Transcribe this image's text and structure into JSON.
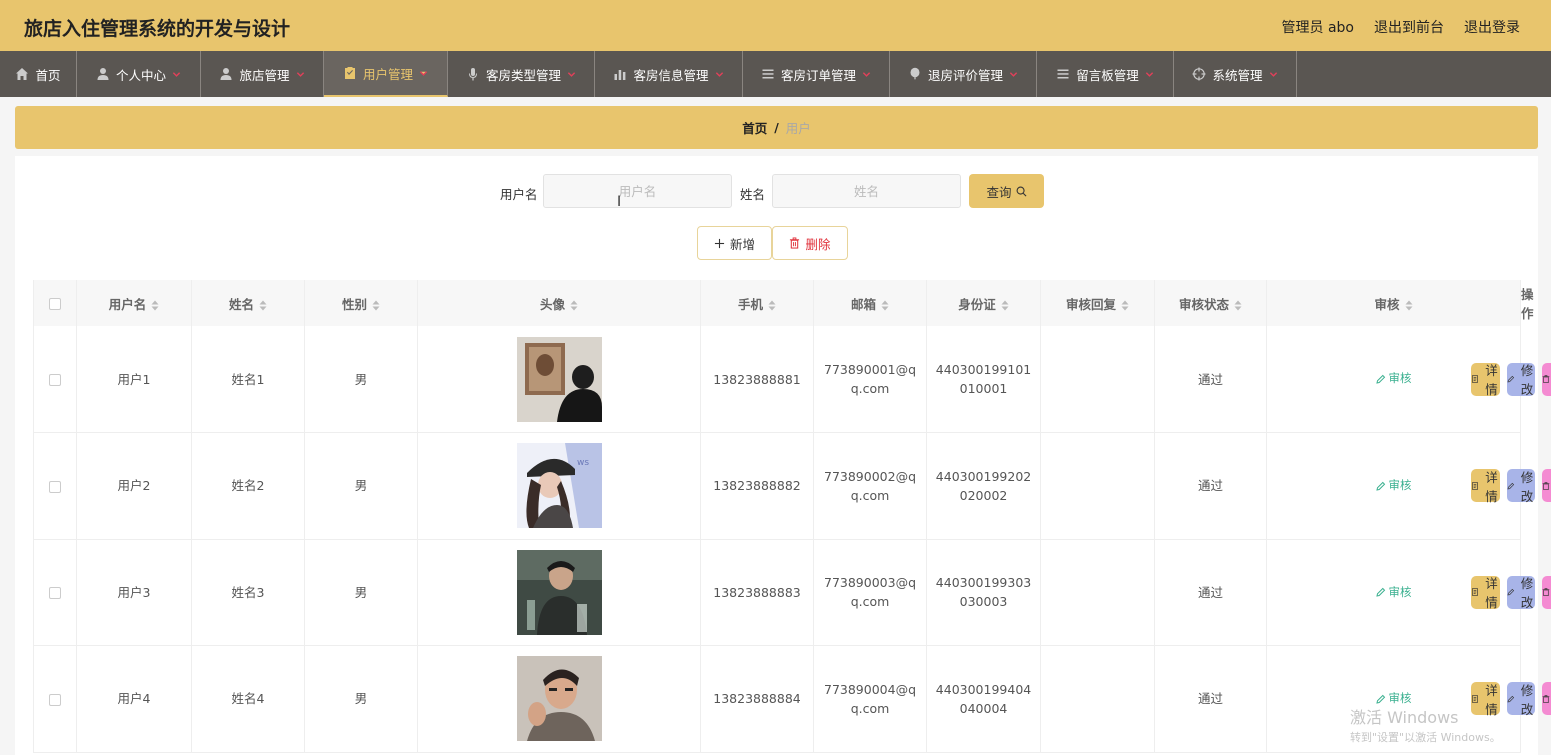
{
  "header": {
    "title": "旅店入住管理系统的开发与设计",
    "admin": "管理员 abo",
    "to_front": "退出到前台",
    "logout": "退出登录"
  },
  "nav": [
    {
      "label": "首页",
      "icon": "home-icon",
      "active": false,
      "dropdown": false
    },
    {
      "label": "个人中心",
      "icon": "user-icon",
      "active": false,
      "dropdown": true
    },
    {
      "label": "旅店管理",
      "icon": "user-icon",
      "active": false,
      "dropdown": true
    },
    {
      "label": "用户管理",
      "icon": "clipboard-icon",
      "active": true,
      "dropdown": true
    },
    {
      "label": "客房类型管理",
      "icon": "mic-icon",
      "active": false,
      "dropdown": true
    },
    {
      "label": "客房信息管理",
      "icon": "bar-chart-icon",
      "active": false,
      "dropdown": true
    },
    {
      "label": "客房订单管理",
      "icon": "list-icon",
      "active": false,
      "dropdown": true
    },
    {
      "label": "退房评价管理",
      "icon": "balloon-icon",
      "active": false,
      "dropdown": true
    },
    {
      "label": "留言板管理",
      "icon": "list-icon",
      "active": false,
      "dropdown": true
    },
    {
      "label": "系统管理",
      "icon": "crosshair-icon",
      "active": false,
      "dropdown": true
    }
  ],
  "breadcrumb": {
    "home": "首页",
    "separator": "/",
    "current": "用户"
  },
  "search": {
    "username_label": "用户名",
    "username_placeholder": "用户名",
    "name_label": "姓名",
    "name_placeholder": "姓名",
    "query_label": "查询"
  },
  "actions": {
    "add_label": "新增",
    "delete_label": "删除"
  },
  "table": {
    "columns": [
      "用户名",
      "姓名",
      "性别",
      "头像",
      "手机",
      "邮箱",
      "身份证",
      "审核回复",
      "审核状态",
      "审核",
      "操作"
    ],
    "rows": [
      {
        "username": "用户1",
        "name": "姓名1",
        "gender": "男",
        "avatar": "avatar-1",
        "phone": "13823888881",
        "email": "773890001@qq.com",
        "id_card": "440300199101010001",
        "reply": "",
        "status": "通过",
        "audit": "审核"
      },
      {
        "username": "用户2",
        "name": "姓名2",
        "gender": "男",
        "avatar": "avatar-2",
        "phone": "13823888882",
        "email": "773890002@qq.com",
        "id_card": "440300199202020002",
        "reply": "",
        "status": "通过",
        "audit": "审核"
      },
      {
        "username": "用户3",
        "name": "姓名3",
        "gender": "男",
        "avatar": "avatar-3",
        "phone": "13823888883",
        "email": "773890003@qq.com",
        "id_card": "440300199303030003",
        "reply": "",
        "status": "通过",
        "audit": "审核"
      },
      {
        "username": "用户4",
        "name": "姓名4",
        "gender": "男",
        "avatar": "avatar-4",
        "phone": "13823888884",
        "email": "773890004@qq.com",
        "id_card": "440300199404040004",
        "reply": "",
        "status": "通过",
        "audit": "审核"
      }
    ],
    "row_actions": {
      "detail": "详情",
      "edit": "修改",
      "delete": "删除"
    }
  },
  "watermark": {
    "line1": "激活 Windows",
    "line2": "转到\"设置\"以激活 Windows。"
  },
  "colors": {
    "accent": "#e8c56d",
    "nav_bg": "#5a5652",
    "detail": "#e8c56d",
    "edit": "#a8b4e8",
    "delete": "#f48bd2",
    "audit": "#3ab08f"
  }
}
